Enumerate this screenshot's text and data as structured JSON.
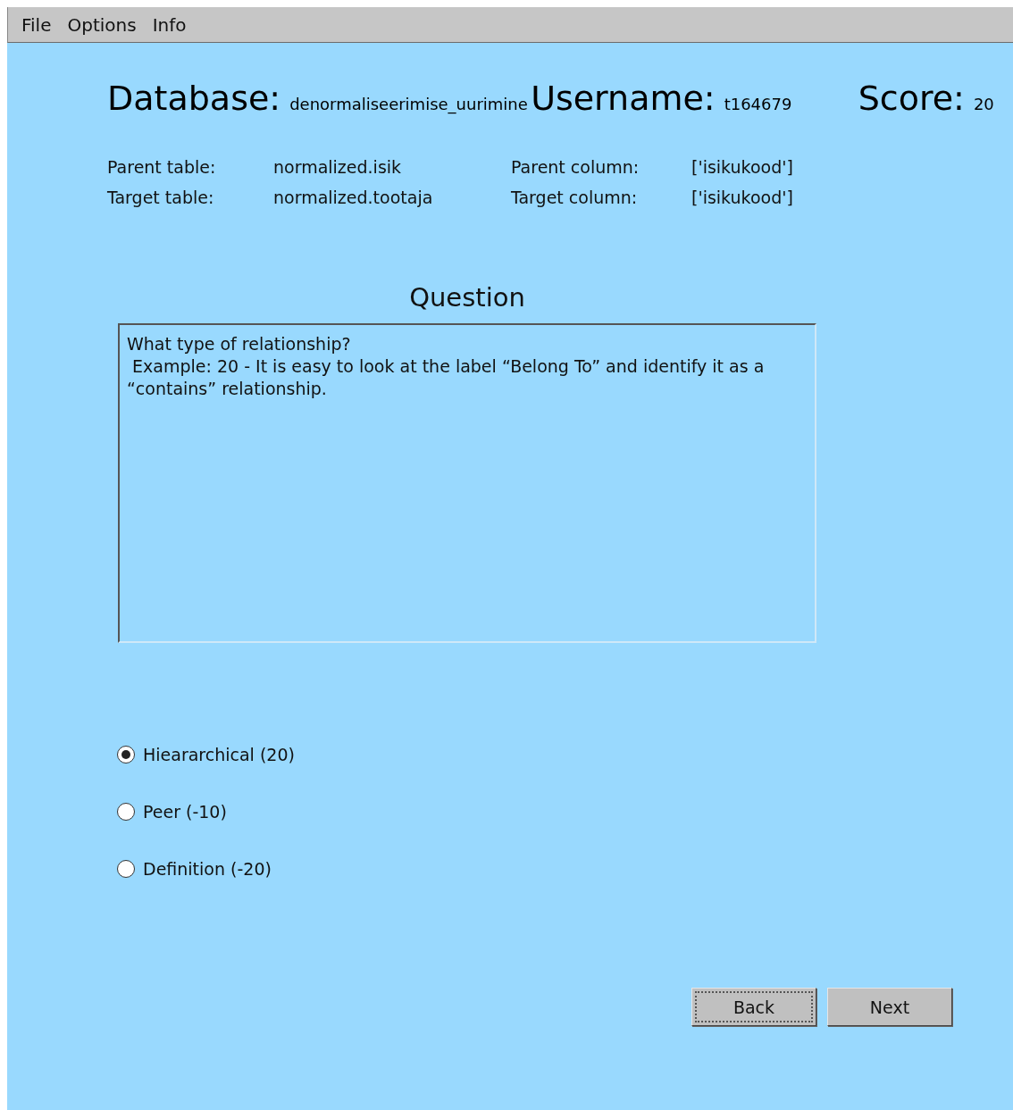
{
  "menu": [
    "File",
    "Options",
    "Info"
  ],
  "header": [
    {
      "label": "Database:",
      "value": "denormaliseerimise_uurimine"
    },
    {
      "label": "Username:",
      "value": "t164679"
    },
    {
      "label": "Score:",
      "value": "20"
    }
  ],
  "details": [
    {
      "label": "Parent table:",
      "value": "normalized.isik"
    },
    {
      "label": "Parent column:",
      "value": "['isikukood']"
    },
    {
      "label": "Target table:",
      "value": "normalized.tootaja"
    },
    {
      "label": "Target column:",
      "value": "['isikukood']"
    }
  ],
  "question": {
    "title": "Question",
    "text": "What type of relationship?\n Example: 20 - It is easy to look at the label “Belong To” and identify it as a “contains” relationship."
  },
  "options": [
    {
      "label": "Hieararchical (20)",
      "selected": true
    },
    {
      "label": "Peer (-10)",
      "selected": false
    },
    {
      "label": "Definition (-20)",
      "selected": false
    }
  ],
  "buttons": [
    {
      "label": "Back",
      "focused": true
    },
    {
      "label": "Next",
      "focused": false
    }
  ]
}
